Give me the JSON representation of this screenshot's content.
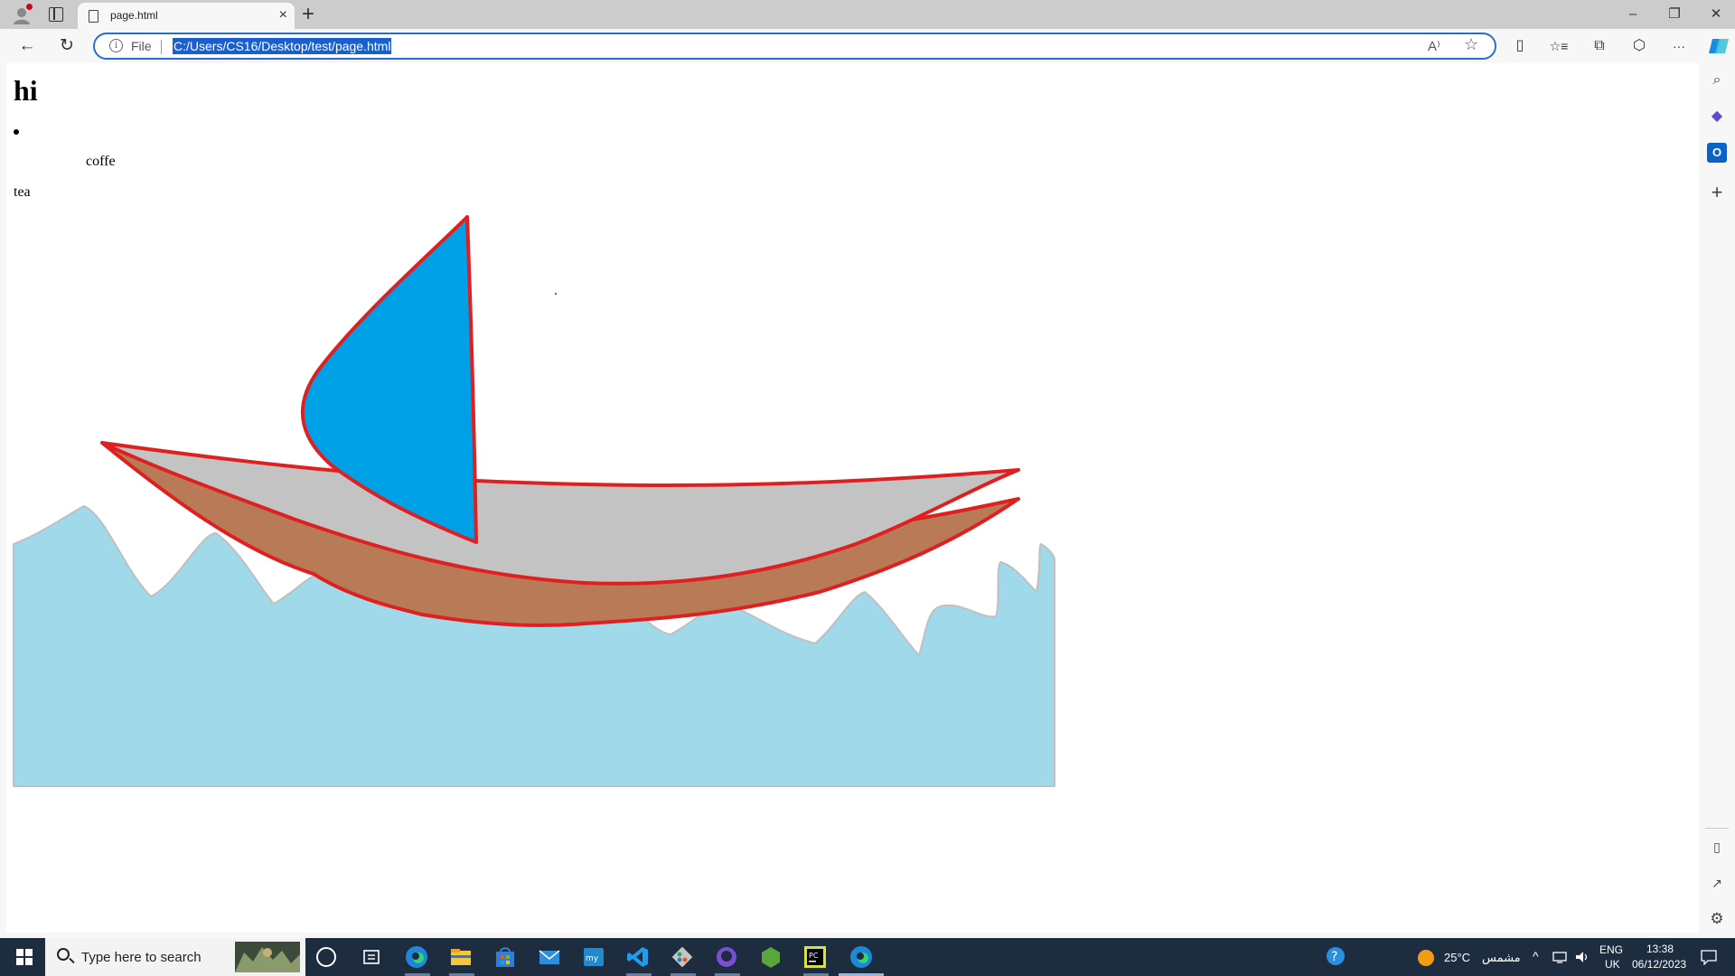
{
  "browser": {
    "tab_title": "page.html",
    "tab_close": "×",
    "new_tab": "+",
    "window_controls": {
      "minimize": "–",
      "restore": "❐",
      "close": "✕"
    }
  },
  "toolbar": {
    "back": "←",
    "reload": "↻",
    "site_info_icon": "i",
    "scheme_label": "File",
    "url": "C:/Users/CS16/Desktop/test/page.html",
    "read_aloud": "A⁾",
    "favorite": "☆",
    "split": "▯",
    "favorites": "☆≡",
    "collections": "⧉",
    "extensions": "⬡",
    "more": "···"
  },
  "sidebar": {
    "items": [
      {
        "name": "search",
        "glyph": "⌕"
      },
      {
        "name": "copilot-apps",
        "glyph": "◆"
      },
      {
        "name": "outlook",
        "glyph": "O"
      },
      {
        "name": "add",
        "glyph": "+"
      }
    ],
    "bottom": [
      {
        "name": "hide-sidebar",
        "glyph": "▯"
      },
      {
        "name": "external",
        "glyph": "↗"
      },
      {
        "name": "settings",
        "glyph": "⚙"
      }
    ]
  },
  "page": {
    "heading": "hi",
    "list_item": "coffe",
    "paragraph": "tea"
  },
  "drawing": {
    "colors": {
      "sail": "#00a0e6",
      "hull_top": "#c3c3c3",
      "hull_bottom": "#b97a57",
      "outline": "#e02020",
      "water": "#9fd9ea",
      "wave_edge": "#c0c0c0"
    }
  },
  "taskbar": {
    "search_placeholder": "Type here to search",
    "apps": [
      "cortana",
      "task-view",
      "edge",
      "file-explorer",
      "store",
      "mail",
      "mysql-workbench",
      "vs-code",
      "git",
      "github-desktop",
      "node",
      "pycharm",
      "edge-active"
    ],
    "weather_temp": "25°C",
    "weather_text": "مشمس",
    "lang_top": "ENG",
    "lang_bottom": "UK",
    "time": "13:38",
    "date": "06/12/2023",
    "colors": {
      "bar": "#1d2c3f",
      "accent": "#8fb8e8"
    }
  }
}
